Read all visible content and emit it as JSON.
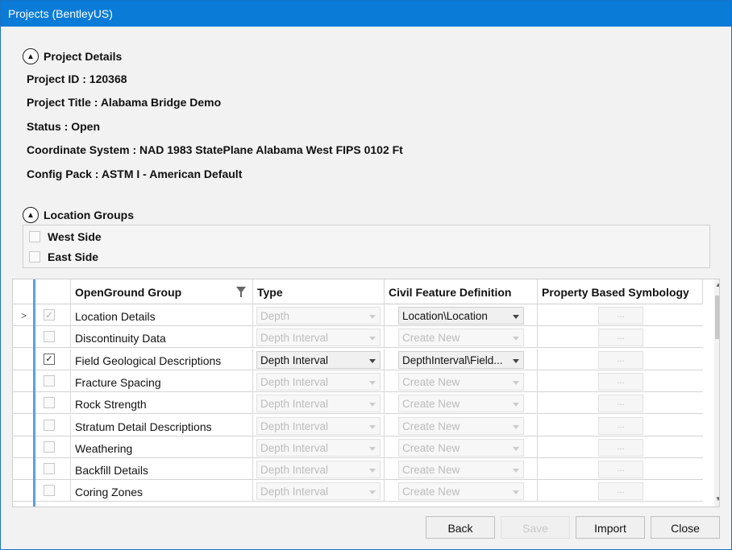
{
  "window": {
    "title": "Projects (BentleyUS)"
  },
  "project_details": {
    "header": "Project Details",
    "fields": [
      {
        "label": "Project ID :",
        "value": "120368"
      },
      {
        "label": "Project Title :",
        "value": "Alabama Bridge Demo"
      },
      {
        "label": "Status :",
        "value": "Open"
      },
      {
        "label": "Coordinate System :",
        "value": "NAD 1983 StatePlane Alabama West FIPS 0102 Ft"
      },
      {
        "label": "Config Pack :",
        "value": "ASTM I - American Default"
      }
    ]
  },
  "location_groups": {
    "header": "Location Groups",
    "items": [
      {
        "label": "West Side",
        "checked": false
      },
      {
        "label": "East Side",
        "checked": false
      }
    ]
  },
  "grid": {
    "columns": {
      "group": "OpenGround Group",
      "type": "Type",
      "civil": "Civil Feature Definition",
      "symbology": "Property Based Symbology"
    },
    "rows": [
      {
        "name": "Location Details",
        "checked": true,
        "enabled": false,
        "current": true,
        "type": "Depth",
        "civil": "Location\\Location",
        "civil_active": true,
        "symbology": "..."
      },
      {
        "name": "Discontinuity Data",
        "checked": false,
        "enabled": false,
        "type": "Depth Interval",
        "civil": "Create New",
        "civil_active": false,
        "symbology": "..."
      },
      {
        "name": "Field Geological Descriptions",
        "checked": true,
        "enabled": true,
        "type": "Depth Interval",
        "civil": "DepthInterval\\Field...",
        "civil_active": true,
        "symbology": "..."
      },
      {
        "name": "Fracture Spacing",
        "checked": false,
        "enabled": false,
        "type": "Depth Interval",
        "civil": "Create New",
        "civil_active": false,
        "symbology": "..."
      },
      {
        "name": "Rock Strength",
        "checked": false,
        "enabled": false,
        "type": "Depth Interval",
        "civil": "Create New",
        "civil_active": false,
        "symbology": "..."
      },
      {
        "name": "Stratum Detail Descriptions",
        "checked": false,
        "enabled": false,
        "type": "Depth Interval",
        "civil": "Create New",
        "civil_active": false,
        "symbology": "..."
      },
      {
        "name": "Weathering",
        "checked": false,
        "enabled": false,
        "type": "Depth Interval",
        "civil": "Create New",
        "civil_active": false,
        "symbology": "..."
      },
      {
        "name": "Backfill Details",
        "checked": false,
        "enabled": false,
        "type": "Depth Interval",
        "civil": "Create New",
        "civil_active": false,
        "symbology": "..."
      },
      {
        "name": "Coring Zones",
        "checked": false,
        "enabled": false,
        "type": "Depth Interval",
        "civil": "Create New",
        "civil_active": false,
        "symbology": "..."
      }
    ]
  },
  "buttons": {
    "back": "Back",
    "save": "Save",
    "import": "Import",
    "close": "Close"
  }
}
